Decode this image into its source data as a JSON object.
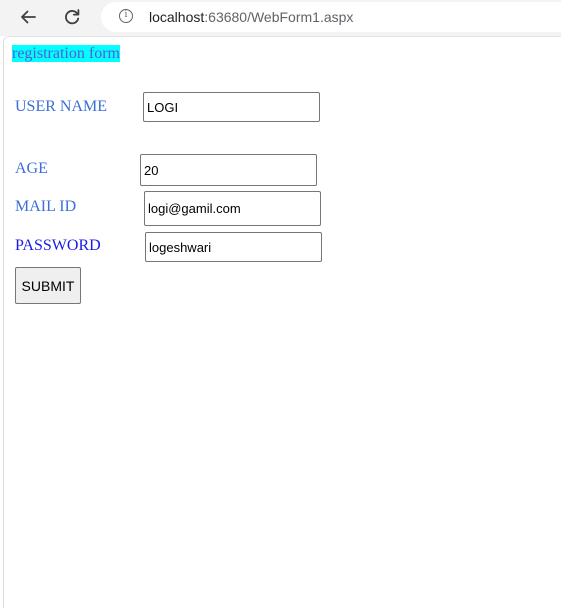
{
  "browser": {
    "url_host": "localhost",
    "url_rest": ":63680/WebForm1.aspx",
    "info_glyph": "i"
  },
  "form": {
    "title": "registration form",
    "username": {
      "label": "USER NAME",
      "value": "LOGI"
    },
    "age": {
      "label": "AGE",
      "value": "20"
    },
    "mail": {
      "label": "MAIL ID",
      "value": "logi@gamil.com"
    },
    "password": {
      "label": "PASSWORD",
      "value": "logeshwari"
    },
    "submit_label": "SUBMIT"
  },
  "colors": {
    "title_background": "#00ffff",
    "label_blue": "#3b6fd6",
    "password_label": "#1a1ae6"
  },
  "icons": {
    "back": "back-arrow-icon",
    "reload": "reload-icon",
    "info": "info-icon"
  }
}
